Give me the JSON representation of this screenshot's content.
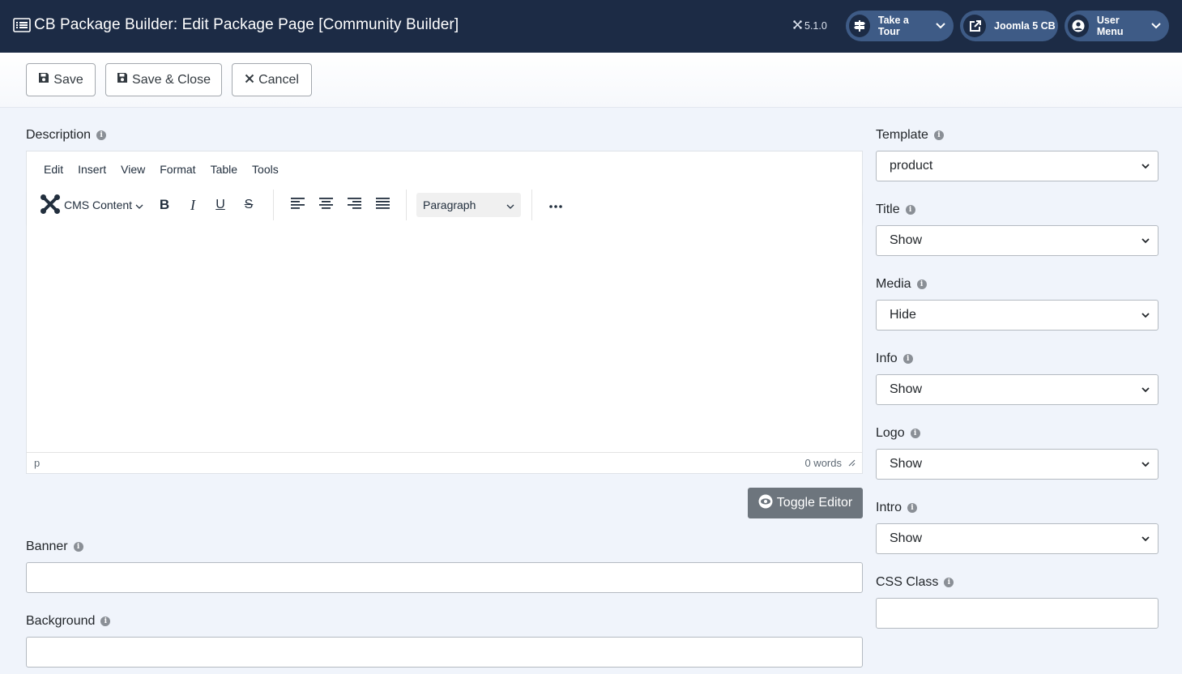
{
  "header": {
    "title": "CB Package Builder: Edit Package Page [Community Builder]",
    "version": "5.1.0",
    "buttons": {
      "tour": "Take a Tour",
      "site": "Joomla 5 CB",
      "user": "User Menu"
    }
  },
  "toolbar": {
    "save": "Save",
    "save_close": "Save & Close",
    "cancel": "Cancel"
  },
  "description": {
    "label": "Description",
    "menu": [
      "Edit",
      "Insert",
      "View",
      "Format",
      "Table",
      "Tools"
    ],
    "cms_content": "CMS Content",
    "block_format": "Paragraph",
    "path": "p",
    "word_count": "0 words",
    "toggle": "Toggle Editor"
  },
  "banner": {
    "label": "Banner",
    "value": ""
  },
  "background": {
    "label": "Background",
    "value": ""
  },
  "sidebar": {
    "template": {
      "label": "Template",
      "value": "product"
    },
    "title": {
      "label": "Title",
      "value": "Show"
    },
    "media": {
      "label": "Media",
      "value": "Hide"
    },
    "info": {
      "label": "Info",
      "value": "Show"
    },
    "logo": {
      "label": "Logo",
      "value": "Show"
    },
    "intro": {
      "label": "Intro",
      "value": "Show"
    },
    "css_class": {
      "label": "CSS Class",
      "value": ""
    }
  },
  "colors": {
    "header_bg": "#1c2b45",
    "header_button_bg": "#3e5b86",
    "page_bg": "#f0f4fb",
    "toggle_bg": "#6d757d"
  }
}
